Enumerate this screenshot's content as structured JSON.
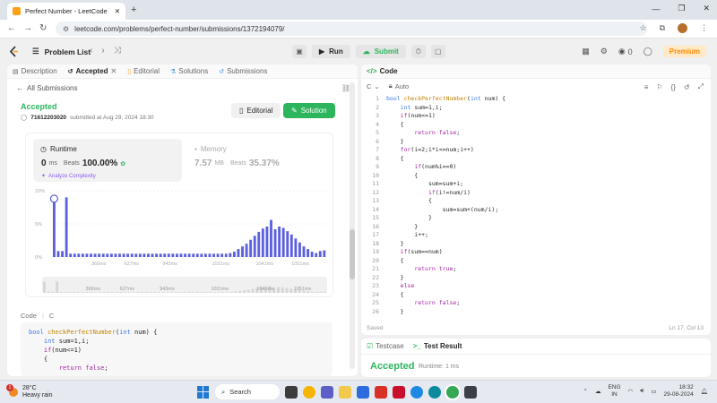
{
  "browser": {
    "tab_title": "Perfect Number - LeetCode",
    "url": "leetcode.com/problems/perfect-number/submissions/1372194079/"
  },
  "topbar": {
    "problem_list": "Problem List",
    "run": "Run",
    "submit": "Submit",
    "coins": "0",
    "premium": "Premium"
  },
  "left_tabs": [
    {
      "label": "Description",
      "active": false
    },
    {
      "label": "Accepted",
      "active": true
    },
    {
      "label": "Editorial",
      "active": false
    },
    {
      "label": "Solutions",
      "active": false
    },
    {
      "label": "Submissions",
      "active": false
    }
  ],
  "submission": {
    "all_submissions": "All Submissions",
    "status": "Accepted",
    "user": "71612203020",
    "submitted_text": "submitted at Aug 29, 2024 18:30",
    "editorial_btn": "Editorial",
    "solution_btn": "Solution",
    "runtime_label": "Runtime",
    "runtime_value": "0",
    "runtime_unit": "ms",
    "beats_label": "Beats",
    "runtime_beats": "100.00%",
    "analyze": "Analyze Complexity",
    "memory_label": "Memory",
    "memory_value": "7.57",
    "memory_unit": "MB",
    "memory_beats": "35.37%",
    "code_label": "Code",
    "code_lang": "C"
  },
  "chart_data": {
    "type": "bar",
    "yticks": [
      "10%",
      "5%",
      "0%"
    ],
    "ylim": [
      0,
      10
    ],
    "xticks": [
      "366ms",
      "627ms",
      "943ms",
      "1031ms",
      "1041ms",
      "1051ms"
    ],
    "values": [
      8.8,
      0.9,
      0.9,
      9.0,
      0.5,
      0.5,
      0.5,
      0.5,
      0.5,
      0.5,
      0.5,
      0.5,
      0.5,
      0.5,
      0.5,
      0.5,
      0.5,
      0.5,
      0.5,
      0.5,
      0.5,
      0.5,
      0.5,
      0.5,
      0.5,
      0.5,
      0.5,
      0.5,
      0.5,
      0.5,
      0.5,
      0.5,
      0.5,
      0.5,
      0.5,
      0.5,
      0.5,
      0.5,
      0.5,
      0.5,
      0.5,
      0.5,
      0.5,
      0.6,
      0.8,
      1.2,
      1.6,
      2.0,
      2.6,
      3.2,
      3.8,
      4.3,
      4.6,
      5.6,
      4.2,
      4.6,
      4.4,
      3.9,
      3.4,
      2.8,
      2.2,
      1.6,
      1.2,
      0.8,
      0.6,
      0.9,
      1.0
    ]
  },
  "code_preview": [
    "bool checkPerfectNumber(int num) {",
    "    int sum=1,i;",
    "    if(num<=1)",
    "    {",
    "        return false;"
  ],
  "editor": {
    "title": "Code",
    "lang": "C",
    "mode": "Auto",
    "saved": "Saved",
    "cursor": "Ln 17, Col 13",
    "lines": [
      "bool checkPerfectNumber(int num) {",
      "    int sum=1,i;",
      "    if(num<=1)",
      "    {",
      "        return false;",
      "    }",
      "    for(i=2;i*i<=num;i++)",
      "    {",
      "        if(num%i==0)",
      "        {",
      "            sum=sum+i;",
      "            if(i!=num/i)",
      "            {",
      "                sum=sum+(num/i);",
      "            }",
      "        }",
      "        i++;",
      "    }",
      "    if(sum==num)",
      "    {",
      "        return true;",
      "    }",
      "    else",
      "    {",
      "        return false;",
      "    }"
    ]
  },
  "bottom": {
    "testcase": "Testcase",
    "test_result": "Test Result",
    "status": "Accepted",
    "runtime": "Runtime: 1 ms"
  },
  "taskbar": {
    "temp": "28°C",
    "weather": "Heavy rain",
    "weather_badge": "1",
    "search": "Search",
    "lang_top": "ENG",
    "lang_bottom": "IN",
    "time": "18:32",
    "date": "29-08-2024"
  }
}
